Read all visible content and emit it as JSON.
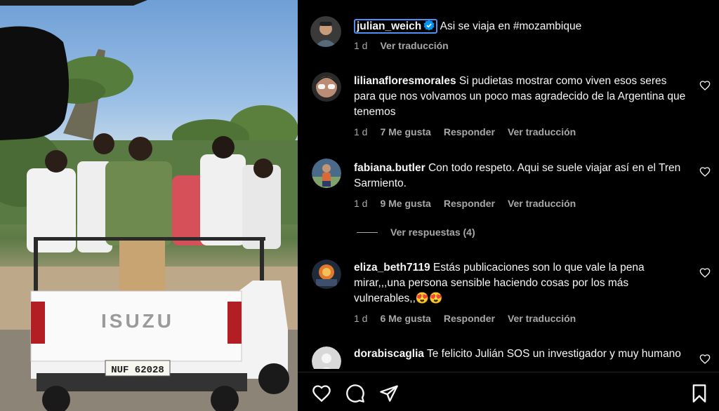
{
  "post": {
    "author": "julian_weich",
    "caption": "Asi se viaja en #mozambique",
    "time": "1 d",
    "translate": "Ver traducción",
    "photo_plate_text": "NUF 62028",
    "photo_brand_text": "ISUZU"
  },
  "comments": [
    {
      "username": "lilianafloresmorales",
      "text": "Si pudietas mostrar como viven esos seres para que nos volvamos un poco mas agradecido de la Argentina que tenemos",
      "time": "1 d",
      "likes": "7 Me gusta",
      "reply": "Responder",
      "translate": "Ver traducción"
    },
    {
      "username": "fabiana.butler",
      "text": "Con todo respeto. Aqui se suele viajar así en el Tren Sarmiento.",
      "time": "1 d",
      "likes": "9 Me gusta",
      "reply": "Responder",
      "translate": "Ver traducción"
    },
    {
      "username": "eliza_beth7119",
      "text": "Estás publicaciones son lo que vale la pena mirar,,,una persona sensible haciendo cosas por los más vulnerables,,😍😍",
      "time": "1 d",
      "likes": "6 Me gusta",
      "reply": "Responder",
      "translate": "Ver traducción"
    },
    {
      "username": "dorabiscaglia",
      "text": "Te felicito Julián SOS un investigador y muy humano"
    }
  ],
  "view_replies": "Ver respuestas (4)",
  "actions": {
    "like_icon": "heart-icon",
    "comment_icon": "comment-icon",
    "share_icon": "paper-plane-icon",
    "save_icon": "bookmark-icon"
  },
  "colors": {
    "background": "#000000",
    "text": "#f5f5f5",
    "muted": "#a8a8a8",
    "verified": "#0095f6",
    "focus_ring": "#4d8ff2"
  }
}
